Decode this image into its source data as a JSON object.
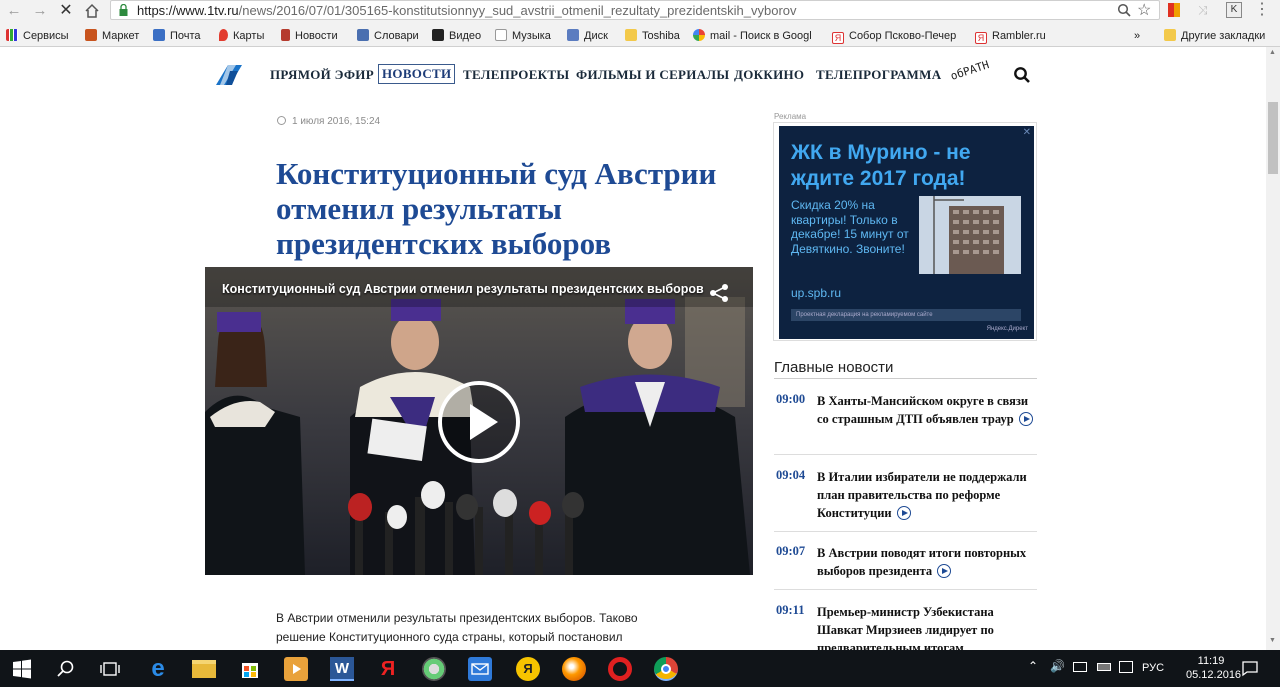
{
  "browser": {
    "url_host": "https://www.1tv.ru",
    "url_path": "/news/2016/07/01/305165-konstitutsionnyy_sud_avstrii_otmenil_rezultaty_prezidentskih_vyborov",
    "bookmarks": [
      "Сервисы",
      "Маркет",
      "Почта",
      "Карты",
      "Новости",
      "Словари",
      "Видео",
      "Музыка",
      "Диск",
      "Toshiba",
      "mail - Поиск в Googl",
      "Собор Псково-Печер",
      "Rambler.ru"
    ],
    "bookmarks_more": "»",
    "other_bookmarks": "Другие закладки"
  },
  "site": {
    "nav": [
      "ПРЯМОЙ ЭФИР",
      "НОВОСТИ",
      "ТЕЛЕПРОЕКТЫ",
      "ФИЛЬМЫ И СЕРИАЛЫ",
      "ДОККИНО",
      "ТЕЛЕПРОГРАММА"
    ],
    "promo": "обРАТН"
  },
  "article": {
    "date": "1 июля 2016, 15:24",
    "headline": "Конституционный суд Австрии отменил результаты президентских выборов",
    "video_title": "Конституционный суд Австрии отменил результаты президентских выборов",
    "body": "В Австрии отменили результаты президентских выборов. Таково решение Конституционного суда страны, который постановил"
  },
  "ad": {
    "label": "Реклама",
    "title": "ЖК в Мурино - не ждите 2017 года!",
    "text": "Скидка 20% на квартиры! Только в декабре! 15 минут от Девяткино. Звоните!",
    "url": "up.spb.ru",
    "declaration": "Проектная декларация на рекламируемом сайте",
    "network": "Яндекс.Директ"
  },
  "main_news": {
    "title": "Главные новости",
    "items": [
      {
        "time": "09:00",
        "text": "В Ханты-Мансийском округе в связи со страшным ДТП объявлен траур",
        "video": true
      },
      {
        "time": "09:04",
        "text": "В Италии избиратели не поддержали план правительства по реформе Конституции",
        "video": true
      },
      {
        "time": "09:07",
        "text": "В Австрии поводят итоги повторных выборов президента",
        "video": true
      },
      {
        "time": "09:11",
        "text": "Премьер-министр Узбекистана Шавкат Мирзиеев лидирует по предварительным итогам",
        "video": false
      }
    ]
  },
  "taskbar": {
    "lang": "РУС",
    "time": "11:19",
    "date": "05.12.2016"
  }
}
